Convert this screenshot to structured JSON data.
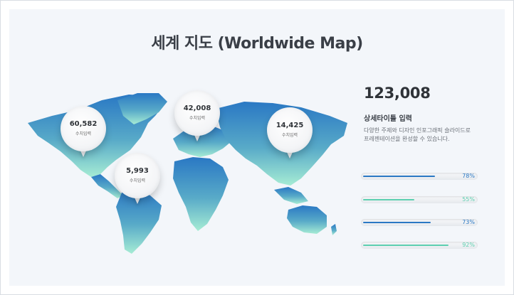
{
  "title": "세계 지도 (Worldwide Map)",
  "pins": [
    {
      "value": "60,582",
      "label": "수치입력"
    },
    {
      "value": "42,008",
      "label": "수치입력"
    },
    {
      "value": "14,425",
      "label": "수치입력"
    },
    {
      "value": "5,993",
      "label": "수치입력"
    }
  ],
  "summary": {
    "total": "123,008",
    "subtitle": "상세타이틀 입력",
    "description_line1": "다양한 주제와 디자인 인포그래픽 슬라이드로",
    "description_line2": "프레젠테이션을 완성할 수 있습니다."
  },
  "bars": [
    {
      "percent": 78,
      "label": "78%",
      "color": "#2a78c4"
    },
    {
      "percent": 55,
      "label": "55%",
      "color": "#5ccfb0"
    },
    {
      "percent": 73,
      "label": "73%",
      "color": "#2a78c4"
    },
    {
      "percent": 92,
      "label": "92%",
      "color": "#5ccfb0"
    }
  ],
  "colors": {
    "map_top": "#2a78c4",
    "map_bottom": "#a6ecd4"
  }
}
